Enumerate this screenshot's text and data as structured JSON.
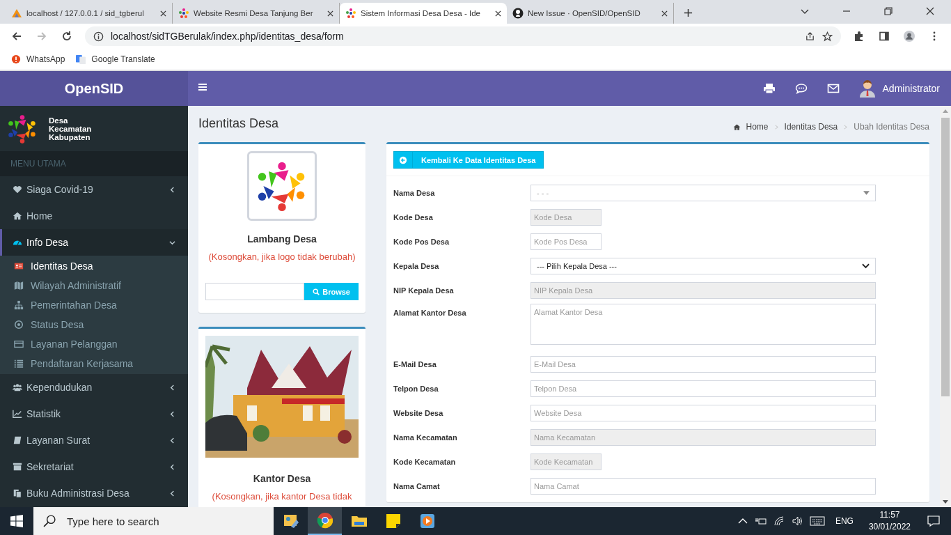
{
  "browser": {
    "tabs": [
      {
        "title": "localhost / 127.0.0.1 / sid_tgberul",
        "selected": false
      },
      {
        "title": "Website Resmi Desa Tanjung Ber",
        "selected": false
      },
      {
        "title": "Sistem Informasi Desa Desa - Ide",
        "selected": true
      },
      {
        "title": "New Issue · OpenSID/OpenSID",
        "selected": false
      }
    ],
    "url": "localhost/sidTGBerulak/index.php/identitas_desa/form",
    "bookmarks": [
      "WhatsApp",
      "Google Translate"
    ]
  },
  "app": {
    "brand": "OpenSID",
    "user": "Administrator",
    "region": [
      "Desa",
      "Kecamatan",
      "Kabupaten"
    ],
    "menu_header": "MENU UTAMA",
    "menu": [
      {
        "label": "Siaga Covid-19",
        "kind": "tree",
        "expanded": false,
        "selected": false
      },
      {
        "label": "Home",
        "kind": "link",
        "selected": false
      },
      {
        "label": "Info Desa",
        "kind": "tree",
        "expanded": true,
        "selected": true,
        "children": [
          {
            "label": "Identitas Desa",
            "selected": true
          },
          {
            "label": "Wilayah Administratif",
            "selected": false
          },
          {
            "label": "Pemerintahan Desa",
            "selected": false
          },
          {
            "label": "Status Desa",
            "selected": false
          },
          {
            "label": "Layanan Pelanggan",
            "selected": false
          },
          {
            "label": "Pendaftaran Kerjasama",
            "selected": false
          }
        ]
      },
      {
        "label": "Kependudukan",
        "kind": "tree",
        "expanded": false,
        "selected": false
      },
      {
        "label": "Statistik",
        "kind": "tree",
        "expanded": false,
        "selected": false
      },
      {
        "label": "Layanan Surat",
        "kind": "tree",
        "expanded": false,
        "selected": false
      },
      {
        "label": "Sekretariat",
        "kind": "tree",
        "expanded": false,
        "selected": false
      },
      {
        "label": "Buku Administrasi Desa",
        "kind": "tree",
        "expanded": false,
        "selected": false
      }
    ]
  },
  "page": {
    "title": "Identitas Desa",
    "breadcrumb": [
      "Home",
      "Identitas Desa",
      "Ubah Identitas Desa"
    ]
  },
  "logo_card": {
    "title": "Lambang Desa",
    "hint": "(Kosongkan, jika logo tidak berubah)",
    "browse": "Browse"
  },
  "office_card": {
    "title": "Kantor Desa",
    "hint": "(Kosongkan, jika kantor Desa tidak",
    "kind": "picture"
  },
  "form": {
    "back_button": "Kembali Ke Data Identitas Desa",
    "fields": [
      {
        "label": "Nama Desa",
        "kind": "combobox",
        "placeholder": "- - -"
      },
      {
        "label": "Kode Desa",
        "kind": "input",
        "short": true,
        "disabled": true,
        "placeholder": "Kode Desa"
      },
      {
        "label": "Kode Pos Desa",
        "kind": "input",
        "short": true,
        "disabled": false,
        "placeholder": "Kode Pos Desa"
      },
      {
        "label": "Kepala Desa",
        "kind": "select",
        "value": "--- Pilih Kepala Desa ---"
      },
      {
        "label": "NIP Kepala Desa",
        "kind": "input",
        "short": false,
        "disabled": true,
        "placeholder": "NIP Kepala Desa"
      },
      {
        "label": "Alamat Kantor Desa",
        "kind": "textarea",
        "placeholder": "Alamat Kantor Desa"
      },
      {
        "label": "E-Mail Desa",
        "kind": "input",
        "short": false,
        "disabled": false,
        "placeholder": "E-Mail Desa"
      },
      {
        "label": "Telpon Desa",
        "kind": "input",
        "short": false,
        "disabled": false,
        "placeholder": "Telpon Desa"
      },
      {
        "label": "Website Desa",
        "kind": "input",
        "short": false,
        "disabled": false,
        "placeholder": "Website Desa"
      },
      {
        "label": "Nama Kecamatan",
        "kind": "input",
        "short": false,
        "disabled": true,
        "placeholder": "Nama Kecamatan"
      },
      {
        "label": "Kode Kecamatan",
        "kind": "input",
        "short": true,
        "disabled": true,
        "placeholder": "Kode Kecamatan"
      },
      {
        "label": "Nama Camat",
        "kind": "input",
        "short": false,
        "disabled": false,
        "placeholder": "Nama Camat"
      }
    ]
  },
  "taskbar": {
    "search_placeholder": "Type here to search",
    "language": "ENG",
    "time": "11:57",
    "date": "30/01/2022"
  }
}
